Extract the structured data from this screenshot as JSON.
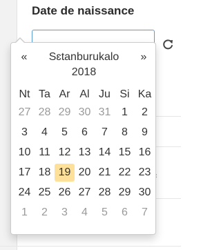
{
  "form": {
    "label": "Date de naissance",
    "date_value": "",
    "refresh_icon": "refresh-icon"
  },
  "background": {
    "partial_text": "f"
  },
  "datepicker": {
    "prev_symbol": "«",
    "next_symbol": "»",
    "month": "Sɛtanburukalo",
    "year": "2018",
    "weekdays": [
      "Nt",
      "Ta",
      "Ar",
      "Al",
      "Ju",
      "Si",
      "Ka"
    ],
    "weeks": [
      [
        {
          "d": "27",
          "t": "old"
        },
        {
          "d": "28",
          "t": "old"
        },
        {
          "d": "29",
          "t": "old"
        },
        {
          "d": "30",
          "t": "old"
        },
        {
          "d": "31",
          "t": "old"
        },
        {
          "d": "1",
          "t": ""
        },
        {
          "d": "2",
          "t": ""
        }
      ],
      [
        {
          "d": "3",
          "t": ""
        },
        {
          "d": "4",
          "t": ""
        },
        {
          "d": "5",
          "t": ""
        },
        {
          "d": "6",
          "t": ""
        },
        {
          "d": "7",
          "t": ""
        },
        {
          "d": "8",
          "t": ""
        },
        {
          "d": "9",
          "t": ""
        }
      ],
      [
        {
          "d": "10",
          "t": ""
        },
        {
          "d": "11",
          "t": ""
        },
        {
          "d": "12",
          "t": ""
        },
        {
          "d": "13",
          "t": ""
        },
        {
          "d": "14",
          "t": ""
        },
        {
          "d": "15",
          "t": ""
        },
        {
          "d": "16",
          "t": ""
        }
      ],
      [
        {
          "d": "17",
          "t": ""
        },
        {
          "d": "18",
          "t": ""
        },
        {
          "d": "19",
          "t": "today"
        },
        {
          "d": "20",
          "t": ""
        },
        {
          "d": "21",
          "t": ""
        },
        {
          "d": "22",
          "t": ""
        },
        {
          "d": "23",
          "t": ""
        }
      ],
      [
        {
          "d": "24",
          "t": ""
        },
        {
          "d": "25",
          "t": ""
        },
        {
          "d": "26",
          "t": ""
        },
        {
          "d": "27",
          "t": ""
        },
        {
          "d": "28",
          "t": ""
        },
        {
          "d": "29",
          "t": ""
        },
        {
          "d": "30",
          "t": ""
        }
      ],
      [
        {
          "d": "1",
          "t": "new"
        },
        {
          "d": "2",
          "t": "new"
        },
        {
          "d": "3",
          "t": "new"
        },
        {
          "d": "4",
          "t": "new"
        },
        {
          "d": "5",
          "t": "new"
        },
        {
          "d": "6",
          "t": "new"
        },
        {
          "d": "7",
          "t": "new"
        }
      ]
    ],
    "colors": {
      "today_highlight": "#fde19a",
      "muted_day": "#9a9a9a",
      "input_focus_border": "#5b9bd5"
    }
  }
}
